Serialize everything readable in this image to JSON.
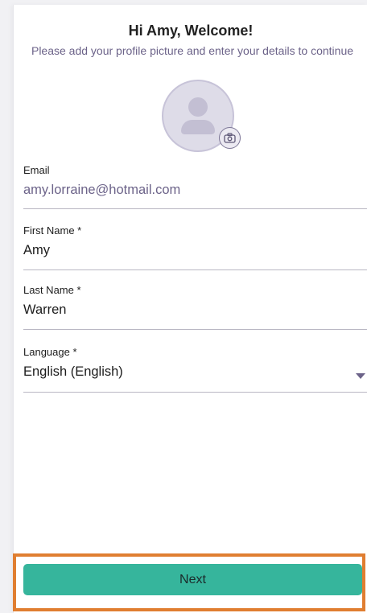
{
  "header": {
    "title": "Hi Amy, Welcome!",
    "subtitle": "Please add your profile picture and enter your details to continue"
  },
  "profile": {
    "avatar_icon": "user-silhouette-icon",
    "camera_icon": "camera-icon"
  },
  "form": {
    "email": {
      "label": "Email",
      "value": "amy.lorraine@hotmail.com"
    },
    "first_name": {
      "label": "First Name *",
      "value": "Amy"
    },
    "last_name": {
      "label": "Last Name *",
      "value": "Warren"
    },
    "language": {
      "label": "Language *",
      "value": "English (English)"
    }
  },
  "actions": {
    "next_label": "Next"
  },
  "colors": {
    "accent": "#36b59c",
    "highlight_border": "#e07e31",
    "muted_text": "#6c6389"
  }
}
